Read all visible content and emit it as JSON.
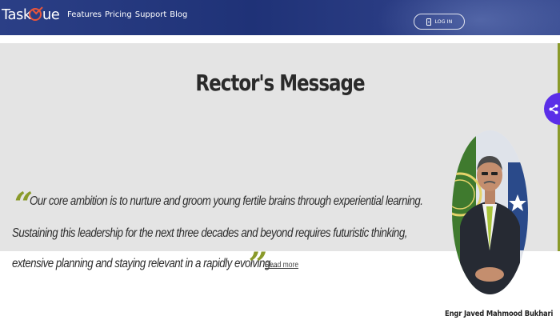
{
  "header": {
    "logo": {
      "text_a": "Task",
      "text_b": "ue"
    },
    "nav": [
      "Features",
      "Pricing",
      "Support",
      "Blog"
    ],
    "login_label": "LOG IN"
  },
  "main": {
    "title": "Rector's Message",
    "quote_lines": [
      "Our core ambition is to nurture and groom young fertile brains through experiential learning.",
      "Sustaining this leadership for the next three decades and beyond requires futuristic thinking,",
      "extensive planning and staying relevant in a rapidly evolving..."
    ],
    "read_more": "Read more",
    "rector_name": "Engr Javed Mahmood Bukhari"
  },
  "colors": {
    "header_bg": "#22357a",
    "band_bg": "#e4e4e4",
    "quote_mark": "#8a9a2a",
    "share_accent": "#5b2ee8",
    "logo_accent": "#e8553b"
  },
  "icons": {
    "share": "share-icon",
    "login": "login-icon"
  }
}
